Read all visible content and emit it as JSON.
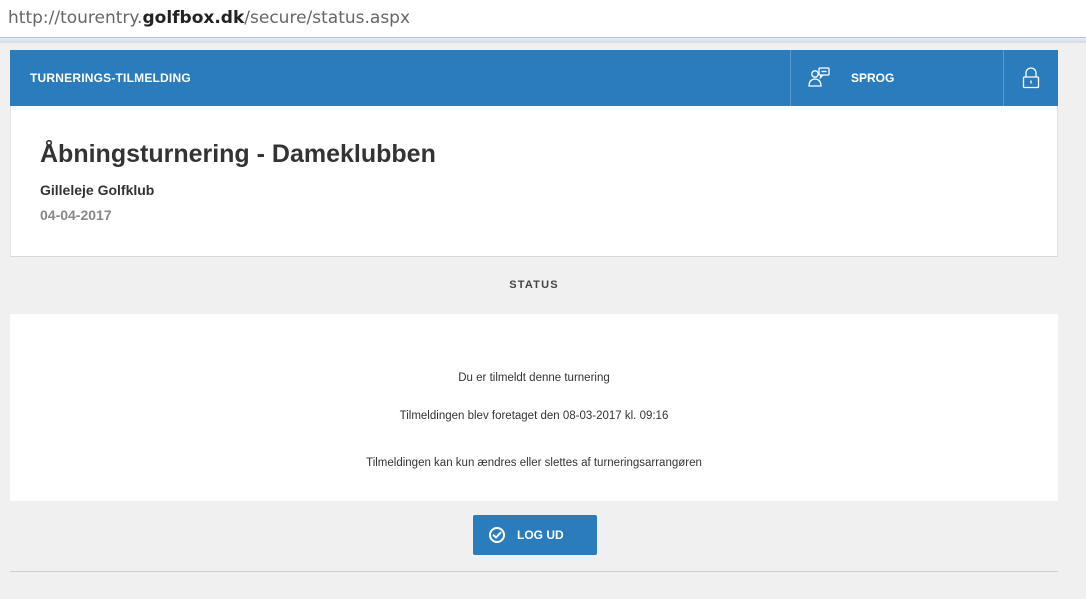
{
  "browser": {
    "url_prefix": "http://tourentry.",
    "url_domain": "golfbox.dk",
    "url_suffix": "/secure/status.aspx"
  },
  "topbar": {
    "title": "TURNERINGS-TILMELDING",
    "language_label": "SPROG",
    "accent_color": "#2b7cbd"
  },
  "tournament": {
    "name": "Åbningsturnering - Dameklubben",
    "club": "Gilleleje Golfklub",
    "date": "04-04-2017"
  },
  "status": {
    "heading": "STATUS",
    "line1": "Du er tilmeldt denne turnering",
    "line2": "Tilmeldingen blev foretaget den 08-03-2017 kl. 09:16",
    "line3": "Tilmeldingen kan kun ændres eller slettes af turneringsarrangøren"
  },
  "actions": {
    "logout_label": "LOG UD",
    "logout_icon": "check-circle-icon"
  }
}
